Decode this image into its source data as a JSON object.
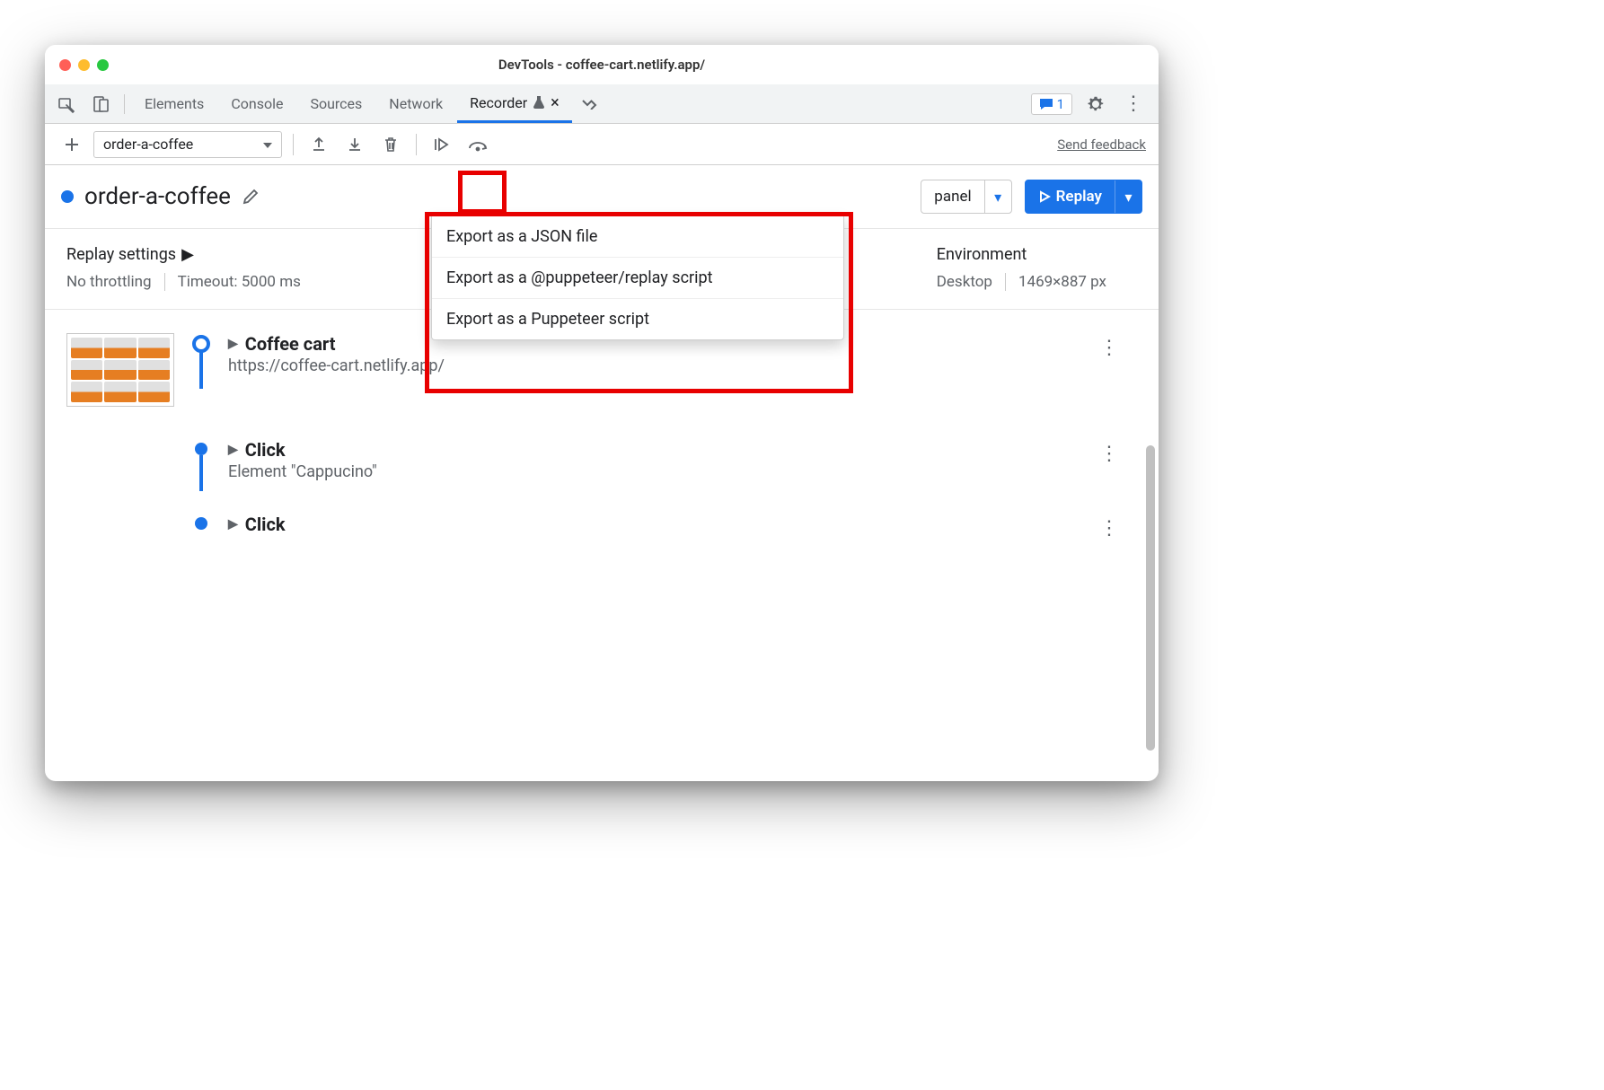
{
  "window": {
    "title": "DevTools - coffee-cart.netlify.app/"
  },
  "tabs": {
    "items": [
      "Elements",
      "Console",
      "Sources",
      "Network",
      "Recorder"
    ],
    "activeIndex": 4
  },
  "messages": {
    "count": "1"
  },
  "recorder": {
    "selector_label": "order-a-coffee",
    "feedback": "Send feedback",
    "recording_name": "order-a-coffee",
    "panel_btn": "panel",
    "replay_btn": "Replay"
  },
  "export_menu": [
    "Export as a JSON file",
    "Export as a @puppeteer/replay script",
    "Export as a Puppeteer script"
  ],
  "settings": {
    "replay_label": "Replay settings",
    "throttle": "No throttling",
    "timeout": "Timeout: 5000 ms",
    "env_label": "Environment",
    "device": "Desktop",
    "viewport": "1469×887 px"
  },
  "steps": [
    {
      "title": "Coffee cart",
      "sub": "https://coffee-cart.netlify.app/",
      "thumb": true,
      "node": "open"
    },
    {
      "title": "Click",
      "sub": "Element \"Cappucino\"",
      "thumb": false,
      "node": "filled"
    },
    {
      "title": "Click",
      "sub": "",
      "thumb": false,
      "node": "filled"
    }
  ]
}
